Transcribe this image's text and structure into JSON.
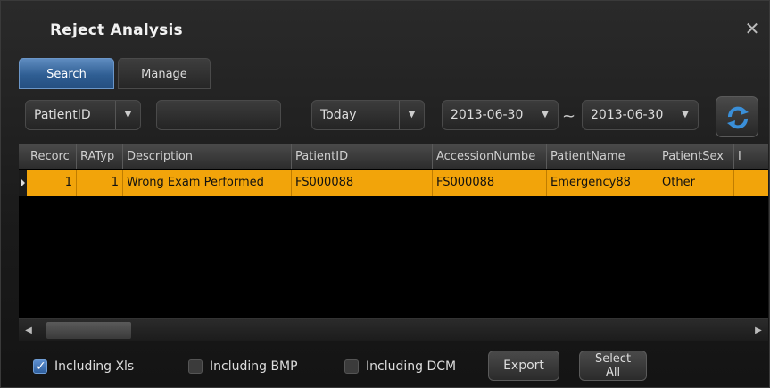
{
  "window": {
    "title": "Reject Analysis",
    "close_label": "✕"
  },
  "tabs": [
    {
      "label": "Search",
      "active": true
    },
    {
      "label": "Manage",
      "active": false
    }
  ],
  "search": {
    "field": "PatientID",
    "value": "",
    "period": "Today",
    "date_from": "2013-06-30",
    "range_separator": "~",
    "date_to": "2013-06-30",
    "dropdown_arrow": "▼"
  },
  "table": {
    "columns": [
      "Recorc",
      "RATyp",
      "Description",
      "PatientID",
      "AccessionNumbe",
      "PatientName",
      "PatientSex",
      "I"
    ],
    "rows": [
      [
        "1",
        "1",
        "Wrong Exam Performed",
        "FS000088",
        "FS000088",
        "Emergency88",
        "Other",
        ""
      ]
    ]
  },
  "scrollbar": {
    "left_arrow": "◀",
    "right_arrow": "▶"
  },
  "options": {
    "xls_label": "Including Xls",
    "xls_checked": true,
    "bmp_label": "Including BMP",
    "bmp_checked": false,
    "dcm_label": "Including DCM",
    "dcm_checked": false
  },
  "buttons": {
    "export_label": "Export",
    "select_all_line1": "Select",
    "select_all_line2": "All"
  },
  "colors": {
    "accent_blue": "#2f5e93",
    "selected_row": "#f2a40a"
  },
  "icons": {
    "refresh": "refresh-icon",
    "close": "close-icon"
  }
}
